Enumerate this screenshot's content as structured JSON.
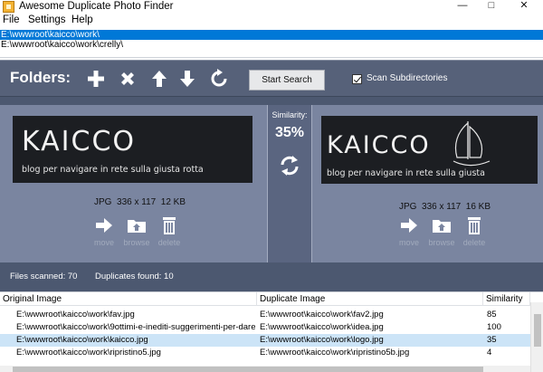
{
  "window": {
    "title": "Awesome Duplicate Photo Finder",
    "controls": [
      "—",
      "□",
      "✕"
    ]
  },
  "menu": [
    "File",
    "Settings",
    "Help"
  ],
  "folders": {
    "items": [
      {
        "path": "E:\\wwwroot\\kaicco\\work\\",
        "selected": true
      },
      {
        "path": "E:\\wwwroot\\kaicco\\work\\crelly\\",
        "selected": false
      }
    ]
  },
  "toolbar": {
    "folders_label": "Folders:",
    "icons": [
      "add-icon",
      "remove-icon",
      "move-up-icon",
      "move-down-icon",
      "reset-icon"
    ],
    "start_search_label": "Start Search",
    "scan_subdirectories_label": "Scan Subdirectories",
    "scan_subdirectories_checked": true
  },
  "left_image": {
    "brand_text": "KAICCO",
    "tagline": "blog per navigare in rete sulla giusta rotta",
    "format": "JPG",
    "dimensions": "336 x 117",
    "size": "12 KB"
  },
  "right_image": {
    "brand_text": "KAICCO",
    "tagline": "blog per navigare in rete sulla giusta",
    "format": "JPG",
    "dimensions": "336 x 117",
    "size": "16 KB"
  },
  "similarity": {
    "label": "Similarity:",
    "value": "35%"
  },
  "actions": {
    "move": "move",
    "browse": "browse",
    "delete": "delete"
  },
  "status": {
    "files_scanned": "Files scanned: 70",
    "duplicates_found": "Duplicates found: 10"
  },
  "results": {
    "columns": [
      "Original Image",
      "Duplicate Image",
      "Similarity"
    ],
    "rows": [
      {
        "original": "E:\\wwwroot\\kaicco\\work\\fav.jpg",
        "duplicate": "E:\\wwwroot\\kaicco\\work\\fav2.jpg",
        "similarity": "85",
        "selected": false
      },
      {
        "original": "E:\\wwwroot\\kaicco\\work\\9ottimi-e-inediti-suggerimenti-per-dare-",
        "duplicate": "E:\\wwwroot\\kaicco\\work\\idea.jpg",
        "similarity": "100",
        "selected": false
      },
      {
        "original": "E:\\wwwroot\\kaicco\\work\\kaicco.jpg",
        "duplicate": "E:\\wwwroot\\kaicco\\work\\logo.jpg",
        "similarity": "35",
        "selected": true
      },
      {
        "original": "E:\\wwwroot\\kaicco\\work\\ripristino5.jpg",
        "duplicate": "E:\\wwwroot\\kaicco\\work\\ripristino5b.jpg",
        "similarity": "4",
        "selected": false
      }
    ]
  },
  "colors": {
    "panel_dark": "#4c5870",
    "panel_light": "#7a85a0",
    "selection": "#0078d7",
    "row_selected": "#cce4f7"
  }
}
